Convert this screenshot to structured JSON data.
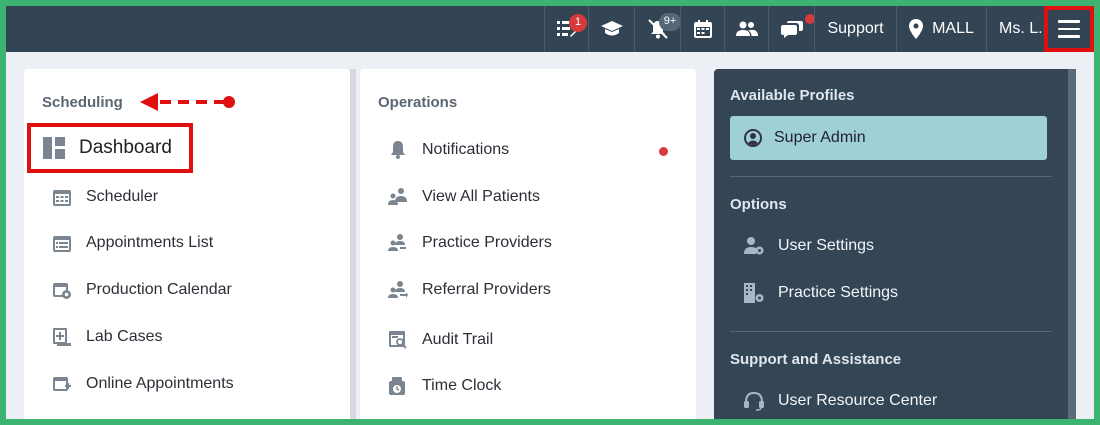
{
  "topbar": {
    "tasks_badge": "1",
    "notifications_badge": "9+",
    "support_label": "Support",
    "location_label": "MALL",
    "user_label": "Ms. L."
  },
  "scheduling": {
    "title": "Scheduling",
    "items": [
      {
        "label": "Dashboard",
        "icon": "dashboard-icon"
      },
      {
        "label": "Scheduler",
        "icon": "calendar-icon"
      },
      {
        "label": "Appointments List",
        "icon": "calendar-list-icon"
      },
      {
        "label": "Production Calendar",
        "icon": "calendar-gear-icon"
      },
      {
        "label": "Lab Cases",
        "icon": "lab-case-icon"
      },
      {
        "label": "Online Appointments",
        "icon": "calendar-plus-icon"
      }
    ]
  },
  "operations": {
    "title": "Operations",
    "items": [
      {
        "label": "Notifications",
        "icon": "bell-icon"
      },
      {
        "label": "View All Patients",
        "icon": "patients-icon"
      },
      {
        "label": "Practice Providers",
        "icon": "providers-icon"
      },
      {
        "label": "Referral Providers",
        "icon": "referral-icon"
      },
      {
        "label": "Audit Trail",
        "icon": "audit-icon"
      },
      {
        "label": "Time Clock",
        "icon": "clock-icon"
      }
    ]
  },
  "right_panel": {
    "profiles_title": "Available Profiles",
    "profile_active": "Super Admin",
    "options_title": "Options",
    "options": [
      {
        "label": "User Settings",
        "icon": "user-gear-icon"
      },
      {
        "label": "Practice Settings",
        "icon": "building-gear-icon"
      }
    ],
    "support_title": "Support and Assistance",
    "support_items": [
      {
        "label": "User Resource Center",
        "icon": "headset-icon"
      }
    ]
  },
  "colors": {
    "topbar": "#334455",
    "highlight": "#e01010",
    "profile_active": "#9fd0d6",
    "notification_dot": "#d63a3a"
  }
}
